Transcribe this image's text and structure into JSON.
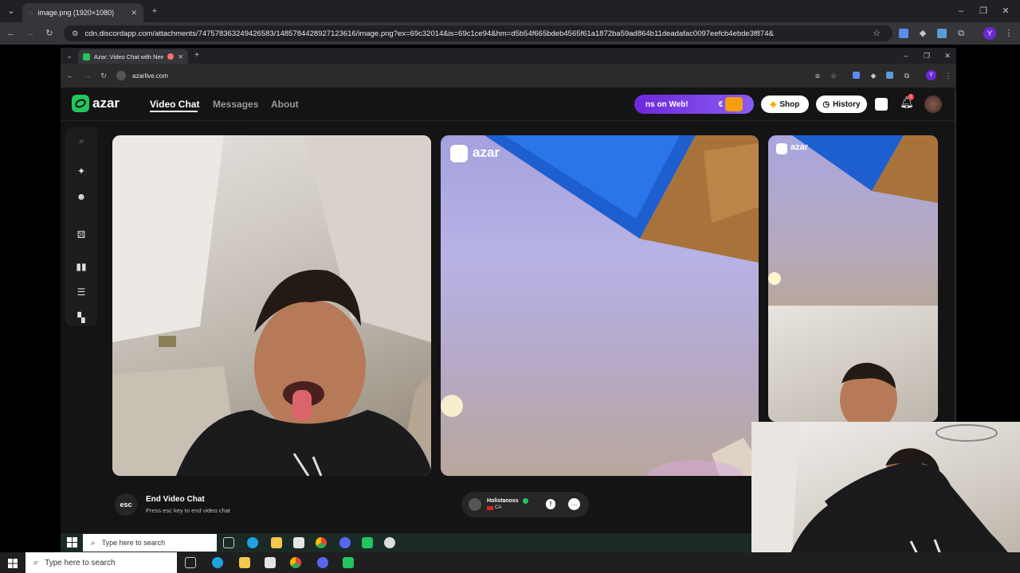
{
  "outer_browser": {
    "tab_title": "image.png (1920×1080)",
    "url": "cdn.discordapp.com/attachments/747578363249426583/1485784428927123616/image.png?ex=69c32014&is=69c1ce94&hm=d5b54f665bdeb4565f61a1872ba59ad864b11deadafac0097eefcb4ebde3f874&",
    "profile_initial": "Y"
  },
  "inner_browser": {
    "tab_title": "Azar: Video Chat with New",
    "url": "azarlive.com",
    "profile_initial": "Y"
  },
  "azar": {
    "logo": "azar",
    "nav": [
      "Video Chat",
      "Messages",
      "About"
    ],
    "active_nav": "Video Chat",
    "promo_text": "ns on Web!",
    "promo_symbol": "€",
    "shop_label": "Shop",
    "history_label": "History",
    "notification_count": "1",
    "remote_watermark": "azar",
    "self_watermark": "azar",
    "esc_key": "esc",
    "end_title": "End Video Chat",
    "end_subtitle": "Press esc key to end video chat",
    "user_name": "Holistanoss",
    "user_country": "CA",
    "accent_color": "#7c3aed",
    "brand_color": "#22c55e"
  },
  "inner_taskbar": {
    "search_placeholder": "Type here to search"
  },
  "outer_taskbar": {
    "search_placeholder": "Type here to search"
  }
}
